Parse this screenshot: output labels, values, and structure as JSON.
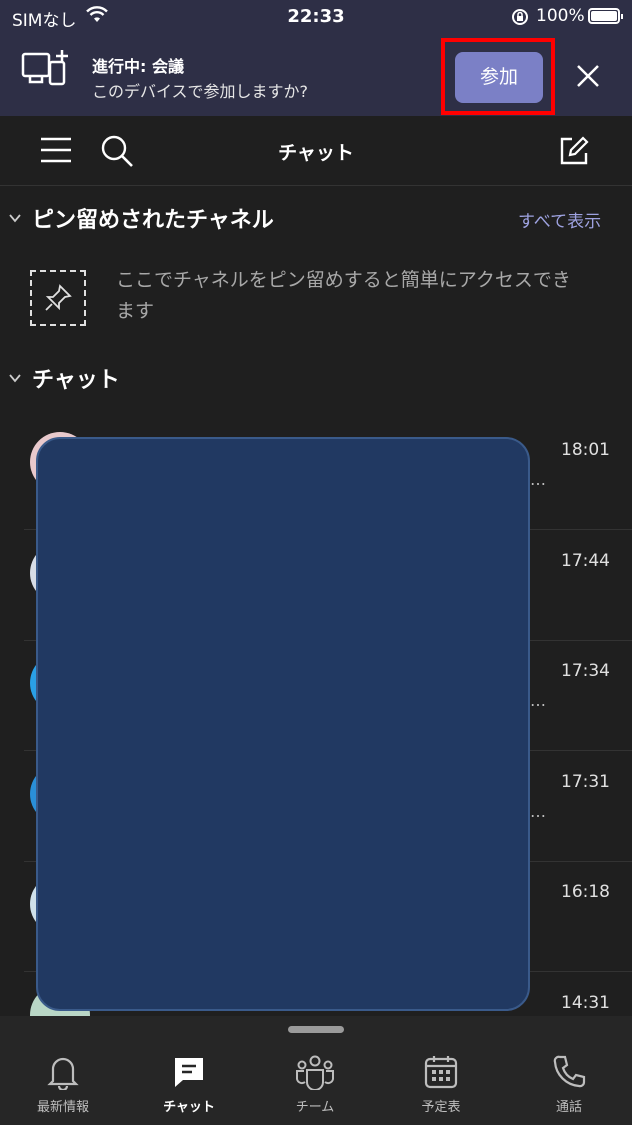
{
  "status_bar": {
    "carrier": "SIMなし",
    "time": "22:33",
    "battery": "100%"
  },
  "banner": {
    "title": "進行中: 会議",
    "subtitle": "このデバイスで参加しますか?",
    "join_label": "参加"
  },
  "header": {
    "title": "チャット"
  },
  "pinned": {
    "title": "ピン留めされたチャネル",
    "show_all": "すべて表示",
    "empty_text": "ここでチャネルをピン留めすると簡単にアクセスできます"
  },
  "chats": {
    "title": "チャット",
    "items": [
      {
        "time": "18:01",
        "avatar_color": "#e8c9cc",
        "dots": "…"
      },
      {
        "time": "17:44",
        "avatar_color": "#d7dde6",
        "dots": ""
      },
      {
        "time": "17:34",
        "avatar_color": "#2aa0e6",
        "dots": "…"
      },
      {
        "time": "17:31",
        "avatar_color": "#2a8fd8",
        "dots": "…"
      },
      {
        "time": "16:18",
        "avatar_color": "#cfe1ea",
        "dots": ""
      },
      {
        "time": "14:31",
        "avatar_color": "#b9d6c6",
        "dots": ""
      }
    ]
  },
  "tabs": [
    {
      "label": "最新情報",
      "icon": "bell-icon"
    },
    {
      "label": "チャット",
      "icon": "chat-icon",
      "active": true
    },
    {
      "label": "チーム",
      "icon": "teams-icon"
    },
    {
      "label": "予定表",
      "icon": "calendar-icon"
    },
    {
      "label": "通話",
      "icon": "phone-icon"
    }
  ],
  "colors": {
    "accent": "#7b80c6",
    "highlight": "#ff0000",
    "banner_bg": "#2e2f46",
    "redaction": "#213962"
  }
}
